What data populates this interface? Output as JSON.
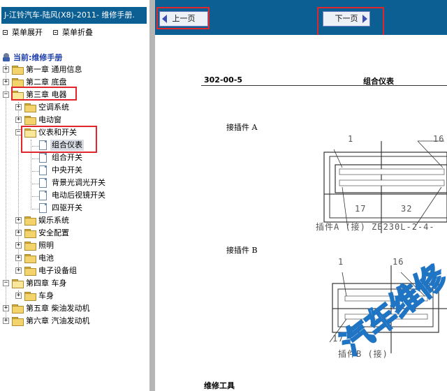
{
  "window_title": "J-江铃汽车-陆风(X8)-2011- 维修手册.",
  "menu_controls": {
    "expand_label": "菜单展开",
    "collapse_label": "菜单折叠"
  },
  "tree": {
    "root_label": "当前:维修手册",
    "ch1": "第一章 通用信息",
    "ch2": "第二章 底盘",
    "ch3": "第三章 电器",
    "ch3_children": {
      "ac": "空调系统",
      "window": "电动窗",
      "instruments": "仪表和开关",
      "instruments_children": {
        "cluster": "组合仪表",
        "combo_switch": "组合开关",
        "central_switch": "中央开关",
        "backlight": "背景光调光开关",
        "mirror": "电动后视镜开关",
        "awd": "四驱开关"
      },
      "entertainment": "娱乐系统",
      "safety": "安全配置",
      "lighting": "照明",
      "battery": "电池",
      "electronics": "电子设备组"
    },
    "ch4": "第四章 车身",
    "ch4_children": {
      "body": "车身"
    },
    "ch5": "第五章 柴油发动机",
    "ch6": "第六章 汽油发动机"
  },
  "nav": {
    "prev_label": "上一页",
    "next_label": "下一页"
  },
  "document": {
    "page_code": "302-00-5",
    "page_title": "组合仪表",
    "connector_a_label": "接插件 A",
    "connector_b_label": "接插件 B",
    "connector_a": {
      "pin_tl": "1",
      "pin_tr": "16",
      "pin_bl": "17",
      "pin_br": "32",
      "caption": "插件A (接) ZB230L-2-4-"
    },
    "connector_b": {
      "pin_tl": "1",
      "pin_tr": "16",
      "pin_bl": "17",
      "caption": "插件B (接)"
    },
    "section_heading": "维修工具",
    "watermark": "汽车维修"
  },
  "colors": {
    "title_bar": "#0c5f93",
    "highlight": "#e0262b",
    "splitter": "#b5b5b5"
  }
}
